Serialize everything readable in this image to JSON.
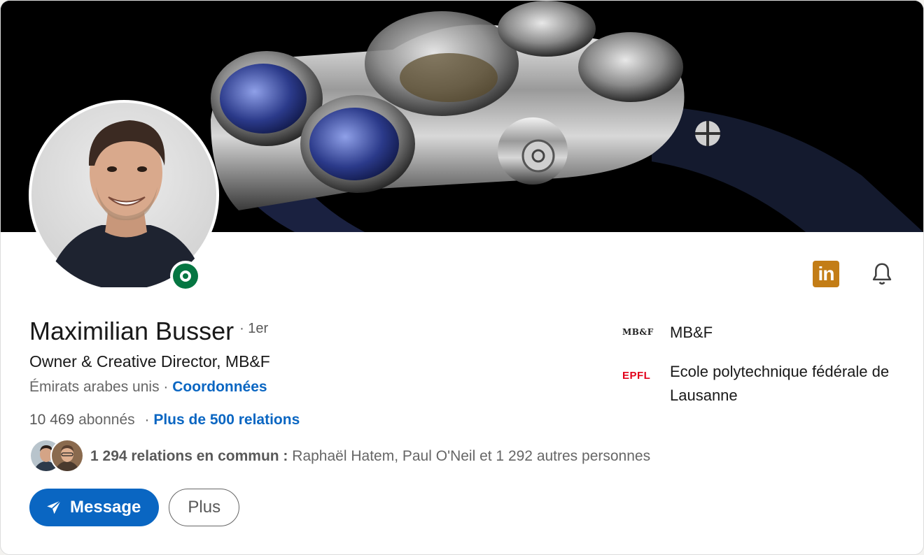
{
  "profile": {
    "name": "Maximilian Busser",
    "degree": "· 1er",
    "headline": "Owner & Creative Director, MB&F",
    "location": "Émirats arabes unis ·",
    "contact_link": "Coordonnées",
    "followers_count": "10 469",
    "followers_label": "abonnés",
    "connections_separator": "·",
    "connections_link": "Plus de 500 relations",
    "mutual_bold": "1 294 relations en commun :",
    "mutual_rest": "Raphaël Hatem, Paul O'Neil et 1 292 autres personnes"
  },
  "organizations": [
    {
      "logo_text": "MB&F",
      "name": "MB&F"
    },
    {
      "logo_text": "EPFL",
      "name": "Ecole polytechnique fédérale de Lausanne"
    }
  ],
  "actions": {
    "message_label": "Message",
    "more_label": "Plus"
  },
  "icons": {
    "linkedin_badge": "in",
    "linkedin_color": "#c37d16",
    "bell": "bell-icon",
    "send": "send-icon"
  },
  "colors": {
    "accent": "#0a66c2",
    "online": "#057642"
  }
}
